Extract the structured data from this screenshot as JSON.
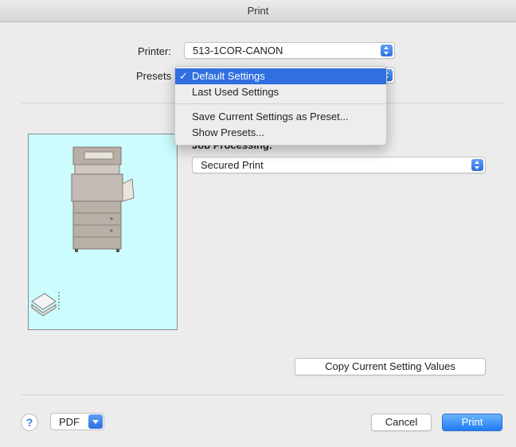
{
  "window": {
    "title": "Print"
  },
  "printer": {
    "label": "Printer:",
    "value": "513-1COR-CANON"
  },
  "presets": {
    "label": "Presets"
  },
  "presets_menu": {
    "items": [
      {
        "label": "Default Settings",
        "checked": true,
        "selected": true
      },
      {
        "label": "Last Used Settings"
      },
      {
        "label": "Save Current Settings as Preset..."
      },
      {
        "label": "Show Presets..."
      }
    ],
    "check_mark": "✓"
  },
  "job_processing": {
    "label_fragment": "Job Processing:",
    "value": "Secured Print"
  },
  "copy_button": {
    "label": "Copy Current Setting Values"
  },
  "footer": {
    "help_label": "?",
    "pdf_label": "PDF",
    "cancel_label": "Cancel",
    "print_label": "Print"
  },
  "colors": {
    "accent": "#2f6fe0",
    "preview_bg": "#ccfcfd",
    "window_bg": "#ececec"
  }
}
